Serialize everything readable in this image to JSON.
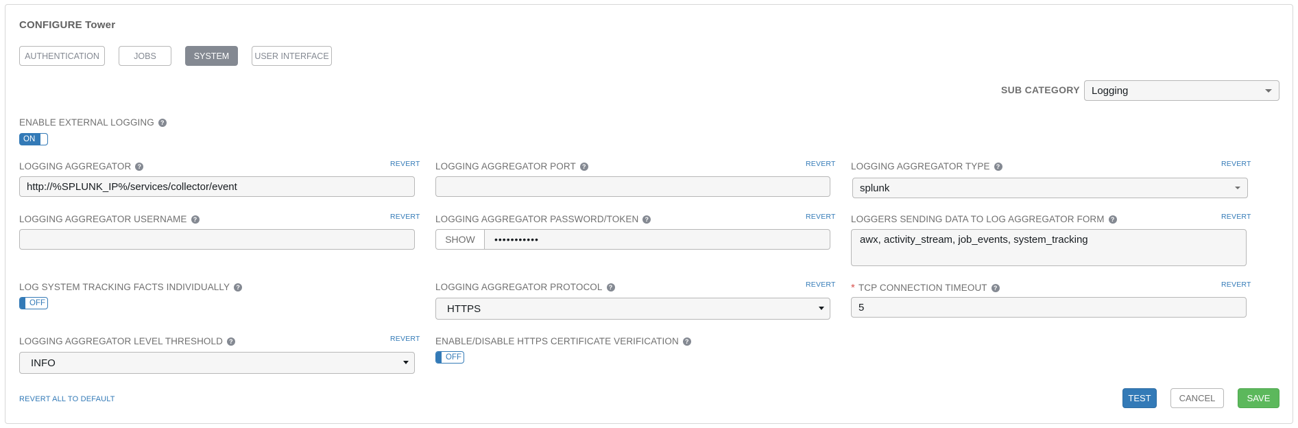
{
  "header": {
    "title": "CONFIGURE Tower"
  },
  "tabs": [
    {
      "label": "AUTHENTICATION",
      "active": false
    },
    {
      "label": "JOBS",
      "active": false
    },
    {
      "label": "SYSTEM",
      "active": true
    },
    {
      "label": "USER INTERFACE",
      "active": false
    }
  ],
  "sub_category": {
    "label": "SUB CATEGORY",
    "value": "Logging"
  },
  "help_glyph": "?",
  "revert_label": "REVERT",
  "fields": {
    "enable_external_logging": {
      "label": "ENABLE EXTERNAL LOGGING",
      "value": "ON"
    },
    "logging_aggregator": {
      "label": "LOGGING AGGREGATOR",
      "value": "http://%SPLUNK_IP%/services/collector/event"
    },
    "logging_aggregator_port": {
      "label": "LOGGING AGGREGATOR PORT",
      "value": ""
    },
    "logging_aggregator_type": {
      "label": "LOGGING AGGREGATOR TYPE",
      "value": "splunk"
    },
    "logging_aggregator_username": {
      "label": "LOGGING AGGREGATOR USERNAME",
      "value": ""
    },
    "logging_aggregator_password": {
      "label": "LOGGING AGGREGATOR PASSWORD/TOKEN",
      "show_label": "SHOW",
      "value": "•••••••••••"
    },
    "loggers_sending_data": {
      "label": "LOGGERS SENDING DATA TO LOG AGGREGATOR FORM",
      "value": "awx, activity_stream, job_events, system_tracking"
    },
    "log_system_tracking_facts": {
      "label": "LOG SYSTEM TRACKING FACTS INDIVIDUALLY",
      "value": "OFF"
    },
    "logging_aggregator_protocol": {
      "label": "LOGGING AGGREGATOR PROTOCOL",
      "value": "HTTPS"
    },
    "tcp_connection_timeout": {
      "label": "TCP CONNECTION TIMEOUT",
      "required_mark": "*",
      "value": "5"
    },
    "logging_aggregator_level_threshold": {
      "label": "LOGGING AGGREGATOR LEVEL THRESHOLD",
      "value": "INFO"
    },
    "https_certificate_verification": {
      "label": "ENABLE/DISABLE HTTPS CERTIFICATE VERIFICATION",
      "value": "OFF"
    }
  },
  "footer": {
    "revert_all": "REVERT ALL TO DEFAULT",
    "test": "TEST",
    "cancel": "CANCEL",
    "save": "SAVE"
  },
  "colors": {
    "primary": "#337ab7",
    "success": "#5cb85c",
    "tab_active": "#848992",
    "required": "#d9534f"
  }
}
